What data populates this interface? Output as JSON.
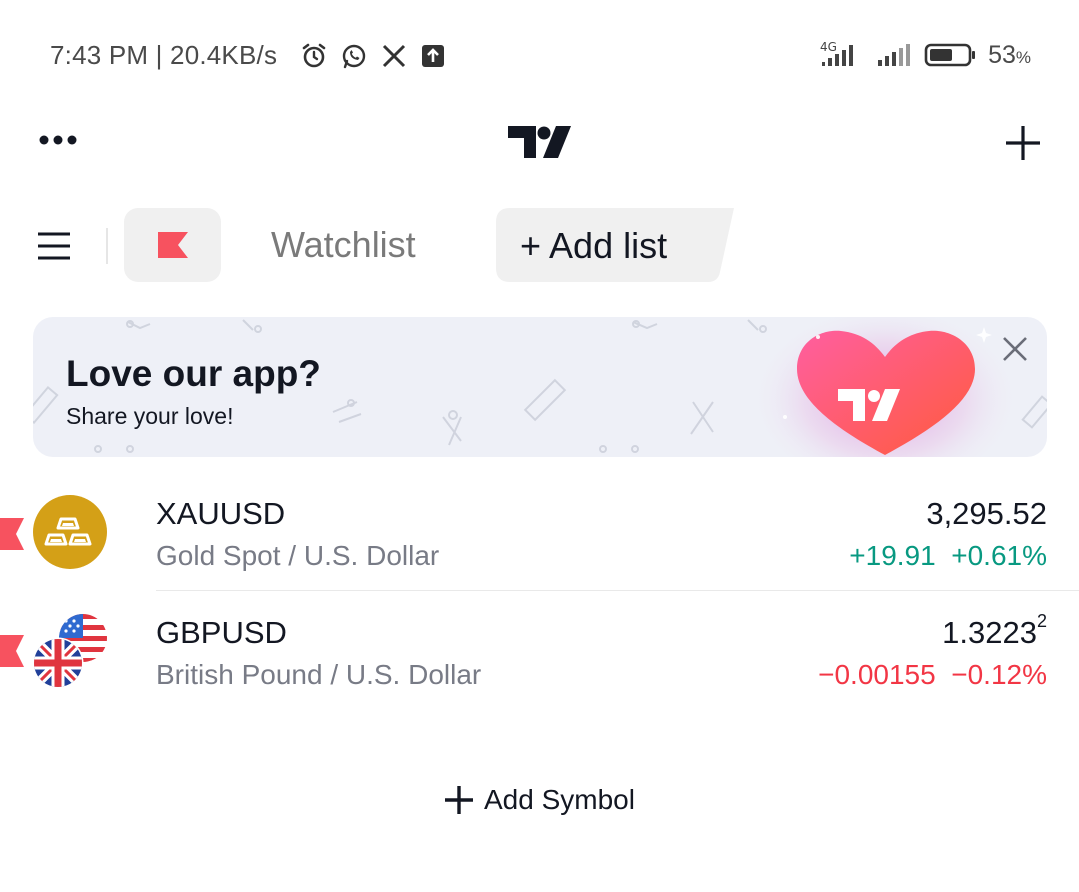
{
  "status_bar": {
    "time": "7:43 PM | 20.4KB/s",
    "network": "4G",
    "battery": "53",
    "battery_unit": "%",
    "icons": [
      "alarm-icon",
      "whatsapp-icon",
      "x-icon",
      "upload-icon"
    ]
  },
  "header": {
    "more_icon": "more-icon",
    "logo": "tradingview-logo",
    "add_icon": "plus-icon"
  },
  "tabs": {
    "watchlist_label": "Watchlist",
    "add_list_label": "Add list"
  },
  "banner": {
    "title": "Love our app?",
    "subtitle": "Share your love!"
  },
  "symbols": [
    {
      "ticker": "XAUUSD",
      "description": "Gold Spot / U.S. Dollar",
      "price": "3,295.52",
      "change": "+19.91",
      "change_pct": "+0.61%",
      "direction": "up"
    },
    {
      "ticker": "GBPUSD",
      "description": "British Pound / U.S. Dollar",
      "price": "1.3223",
      "price_sup": "2",
      "change": "−0.00155",
      "change_pct": "−0.12%",
      "direction": "down"
    }
  ],
  "add_symbol_label": "Add Symbol",
  "colors": {
    "accent_red": "#f7525f",
    "up": "#089981",
    "down": "#f23645",
    "gold": "#d4a017"
  }
}
